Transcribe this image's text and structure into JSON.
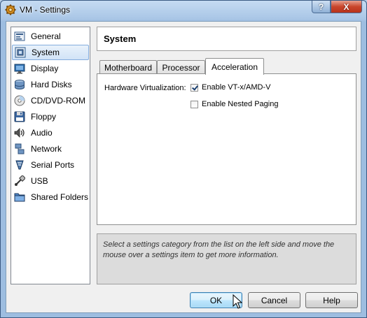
{
  "window": {
    "title": "VM - Settings"
  },
  "titlebar": {
    "help_glyph": "?",
    "close_glyph": "X"
  },
  "sidebar": {
    "selected_index": 1,
    "items": [
      {
        "label": "General",
        "icon": "general-icon"
      },
      {
        "label": "System",
        "icon": "system-icon"
      },
      {
        "label": "Display",
        "icon": "display-icon"
      },
      {
        "label": "Hard Disks",
        "icon": "hard-disk-icon"
      },
      {
        "label": "CD/DVD-ROM",
        "icon": "cd-dvd-icon"
      },
      {
        "label": "Floppy",
        "icon": "floppy-icon"
      },
      {
        "label": "Audio",
        "icon": "audio-icon"
      },
      {
        "label": "Network",
        "icon": "network-icon"
      },
      {
        "label": "Serial Ports",
        "icon": "serial-port-icon"
      },
      {
        "label": "USB",
        "icon": "usb-icon"
      },
      {
        "label": "Shared Folders",
        "icon": "shared-folder-icon"
      }
    ]
  },
  "page": {
    "title": "System",
    "tabs": [
      {
        "label": "Motherboard"
      },
      {
        "label": "Processor"
      },
      {
        "label": "Acceleration"
      }
    ],
    "active_tab": 2,
    "acceleration": {
      "hv_label": "Hardware Virtualization:",
      "vtx": {
        "label": "Enable VT-x/AMD-V",
        "checked": true
      },
      "nested_paging": {
        "label": "Enable Nested Paging",
        "checked": false
      }
    },
    "info": "Select a settings category from the list on the left side and move the mouse over a settings item to get more information."
  },
  "buttons": {
    "ok": "OK",
    "cancel": "Cancel",
    "help": "Help"
  },
  "colors": {
    "selection_border": "#84acdd",
    "default_button_border": "#3c7fb1",
    "close_red": "#c9462c"
  }
}
